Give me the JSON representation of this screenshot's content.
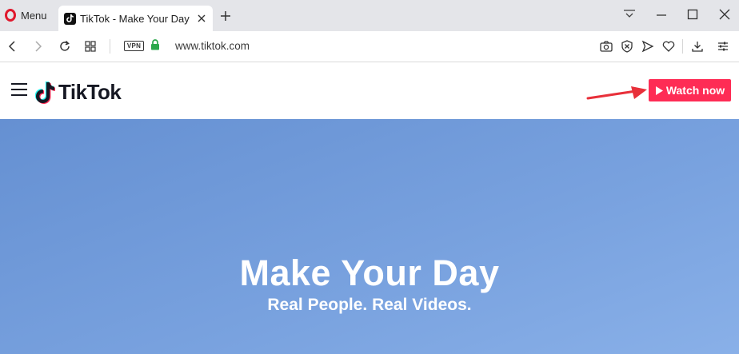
{
  "browser": {
    "menu_label": "Menu",
    "tab": {
      "title": "TikTok - Make Your Day"
    },
    "address": {
      "vpn_label": "VPN",
      "url": "www.tiktok.com"
    }
  },
  "site": {
    "brand": "TikTok",
    "watch_now_label": "Watch now",
    "hero": {
      "title": "Make Your Day",
      "subtitle": "Real People. Real Videos."
    }
  },
  "colors": {
    "accent_button": "#fe2c55",
    "hero_bg": "#7099d8",
    "annotation_arrow": "#e8303a"
  },
  "icons": [
    "opera-logo-icon",
    "tiktok-note-icon",
    "close-icon",
    "plus-icon",
    "tab-menu-icon",
    "minimize-icon",
    "maximize-icon",
    "window-close-icon",
    "back-icon",
    "forward-icon",
    "reload-icon",
    "speed-dial-icon",
    "lock-icon",
    "camera-icon",
    "adblock-icon",
    "send-icon",
    "heart-icon",
    "download-icon",
    "easy-setup-icon",
    "hamburger-icon",
    "play-icon",
    "arrow-icon"
  ]
}
